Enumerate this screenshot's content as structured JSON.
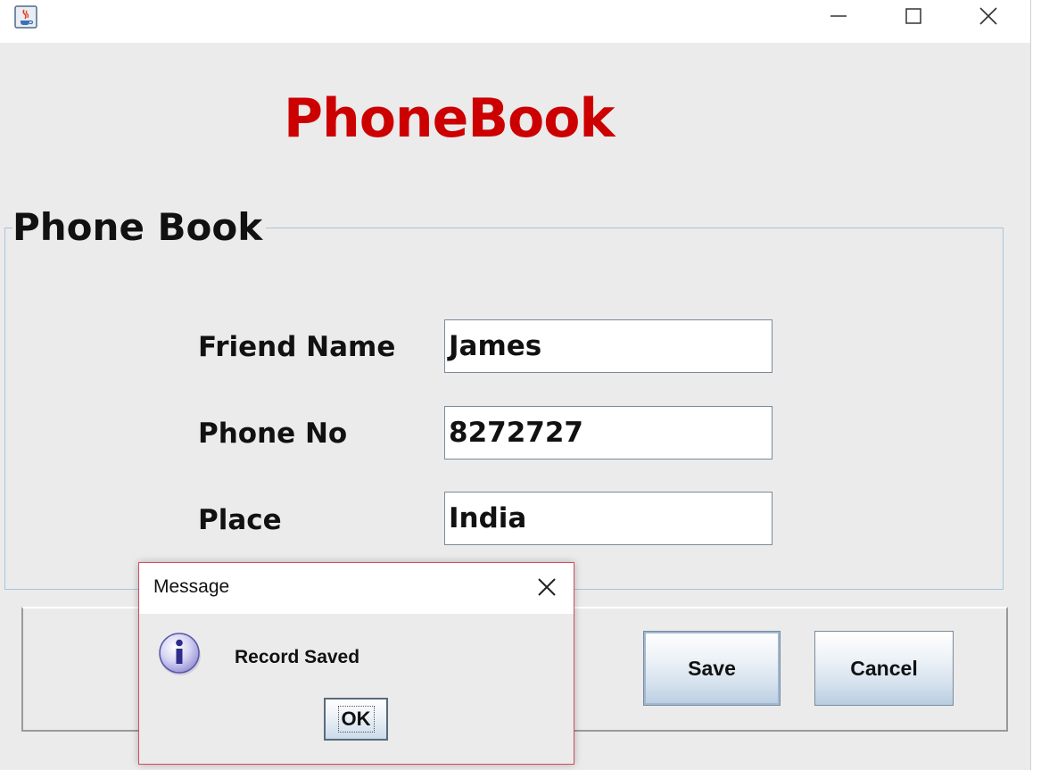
{
  "window": {
    "title": "",
    "icon": "java-cup-icon",
    "controls": [
      "minimize-icon",
      "maximize-icon",
      "close-icon"
    ]
  },
  "header": {
    "title": "PhoneBook",
    "color": "#cc0000"
  },
  "panel": {
    "title": "Phone Book"
  },
  "form": {
    "fields": [
      {
        "label": "Friend Name",
        "value": "James"
      },
      {
        "label": "Phone No",
        "value": "8272727"
      },
      {
        "label": "Place",
        "value": "India"
      }
    ]
  },
  "buttons": {
    "save": "Save",
    "cancel": "Cancel"
  },
  "dialog": {
    "title": "Message",
    "icon": "information-icon",
    "message": "Record Saved",
    "ok": "OK",
    "border_color": "#d24b5e"
  }
}
